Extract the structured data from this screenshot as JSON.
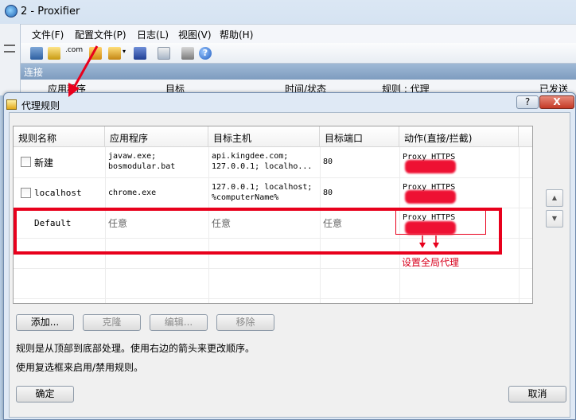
{
  "main_window": {
    "title": "2 - Proxifier",
    "menu": [
      "文件(F)",
      "配置文件(P)",
      "日志(L)",
      "视图(V)",
      "帮助(H)"
    ],
    "toolbar_com": ".com",
    "connections_label": "连接",
    "columns": [
      "应用程序",
      "目标",
      "时间/状态",
      "规则 : 代理",
      "已发送"
    ]
  },
  "dialog": {
    "title": "代理规则",
    "help_label": "?",
    "close_label": "X",
    "table": {
      "headers": [
        "规则名称",
        "应用程序",
        "目标主机",
        "目标端口",
        "动作(直接/拦截)"
      ],
      "rows": [
        {
          "name": "新建",
          "apps": [
            "javaw.exe;",
            "bosmodular.bat"
          ],
          "hosts": [
            "api.kingdee.com;",
            "127.0.0.1; localho..."
          ],
          "port": "80",
          "action": "Proxy HTTPS",
          "checkbox": true
        },
        {
          "name": "localhost",
          "apps": [
            "chrome.exe"
          ],
          "hosts": [
            "127.0.0.1; localhost;",
            "%computerName%"
          ],
          "port": "80",
          "action": "Proxy HTTPS",
          "checkbox": true
        },
        {
          "name": "Default",
          "apps": [
            "任意"
          ],
          "hosts": [
            "任意"
          ],
          "port": "任意",
          "action": "Proxy HTTPS",
          "checkbox": false
        }
      ]
    },
    "buttons": {
      "add": "添加...",
      "clone": "克隆",
      "edit": "编辑...",
      "remove": "移除"
    },
    "hint1": "规则是从顶部到底部处理。使用右边的箭头来更改顺序。",
    "hint2": "使用复选框来启用/禁用规则。",
    "ok": "确定",
    "cancel": "取消"
  },
  "annotation": {
    "text": "设置全局代理",
    "color": "#e8001c"
  }
}
